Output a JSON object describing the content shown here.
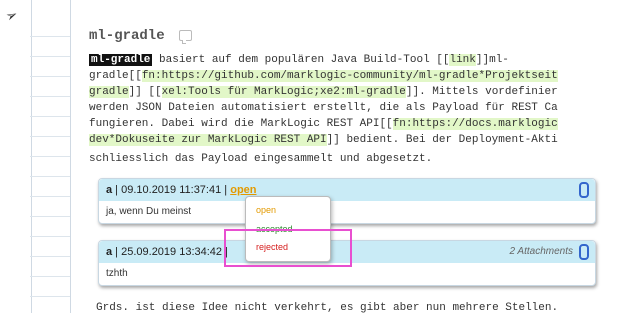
{
  "page": {
    "title": "ml-gradle",
    "paragraph": {
      "line1_tag": "ml-gradle",
      "line1_text": " basiert auf dem populären Java Build-Tool [[",
      "line1_link": "link",
      "line1_tail": "]]ml-",
      "line2_a": "gradle[[",
      "line2_hl": "fn:https://github.com/marklogic-community/ml-gradle*Projektseit",
      "line3_a": "gradle",
      "line3_b": "]] [[",
      "line3_hl": "xel:Tools für MarkLogic;xe2:ml-gradle",
      "line3_c": "]]. Mittels vordefinier",
      "line4": "werden JSON Dateien automatisiert erstellt, die als Payload für REST Ca",
      "line5_a": "fungieren. Dabei wird die MarkLogic REST API[[",
      "line5_hl": "fn:https://docs.marklogic",
      "line6_hl": "dev*Dokuseite zur MarkLogic REST API",
      "line6_b": "]] bedient. Bei der Deployment-Akti",
      "line7": "schliesslich das Payload eingesammelt und abgesetzt."
    },
    "footer_text": "Grds. ist diese Idee nicht verkehrt, es gibt aber nun mehrere Stellen."
  },
  "comments": [
    {
      "author": "a",
      "sep": " | ",
      "date": "09.10.2019 11:37:41",
      "bar": " | ",
      "status": "open",
      "body": "ja, wenn Du meinst",
      "attachments": ""
    },
    {
      "author": "a",
      "sep": " | ",
      "date": "25.09.2019 13:34:42",
      "bar": " | ",
      "status": "",
      "body": "tzhth",
      "attachments": "2 Attachments"
    }
  ],
  "status_dropdown": {
    "options": [
      "open",
      "accepted",
      "rejected"
    ],
    "colors": [
      "#e39a00",
      "#2e8b2e",
      "#d62020"
    ]
  },
  "colors": {
    "comment_header": "#c9ebf6",
    "highlight": "#e2f7c8",
    "annotation_box": "#e84fd0"
  },
  "icons": [
    "cursor-arrow-icon",
    "document-comment-icon",
    "paperclip-icon"
  ]
}
